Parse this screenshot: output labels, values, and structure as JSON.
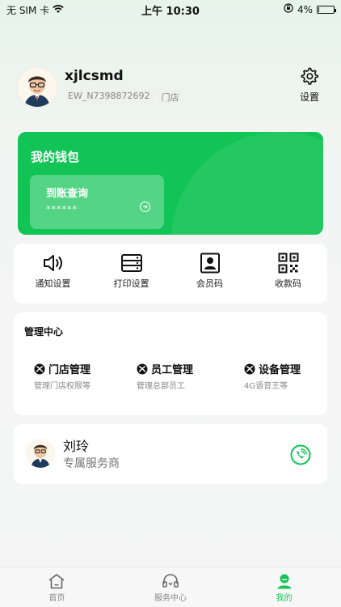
{
  "status_bar": {
    "carrier": "无 SIM 卡",
    "time": "上午 10:30",
    "battery": "4%",
    "battery_level": 0.04
  },
  "profile": {
    "username": "xjlcsmd",
    "account_id": "EW_N7398872692",
    "role_tag": "门店",
    "settings_label": "设置",
    "avatar_icon": "man-with-glasses-avatar"
  },
  "wallet": {
    "title": "我的钱包",
    "card_title": "到账查询",
    "card_value": "******",
    "accent": "#12c456"
  },
  "quick_actions": [
    {
      "label": "通知设置",
      "icon": "speaker-icon"
    },
    {
      "label": "打印设置",
      "icon": "printer-icon"
    },
    {
      "label": "会员码",
      "icon": "member-card-icon"
    },
    {
      "label": "收款码",
      "icon": "qr-code-icon"
    }
  ],
  "management": {
    "title": "管理中心",
    "items": [
      {
        "title": "门店管理",
        "subtitle": "管理门店权限等",
        "icon": "xbox-icon"
      },
      {
        "title": "员工管理",
        "subtitle": "管理总部员工",
        "icon": "xbox-icon"
      },
      {
        "title": "设备管理",
        "subtitle": "4G语音王等",
        "icon": "xbox-icon"
      }
    ]
  },
  "service": {
    "name": "刘玲",
    "role": "专属服务商",
    "icon": "phone-icon"
  },
  "tabbar": {
    "tabs": [
      {
        "label": "首页",
        "icon": "home-icon",
        "active": false
      },
      {
        "label": "服务中心",
        "icon": "headset-icon",
        "active": false
      },
      {
        "label": "我的",
        "icon": "user-icon",
        "active": true
      }
    ],
    "active_color": "#12c456"
  }
}
